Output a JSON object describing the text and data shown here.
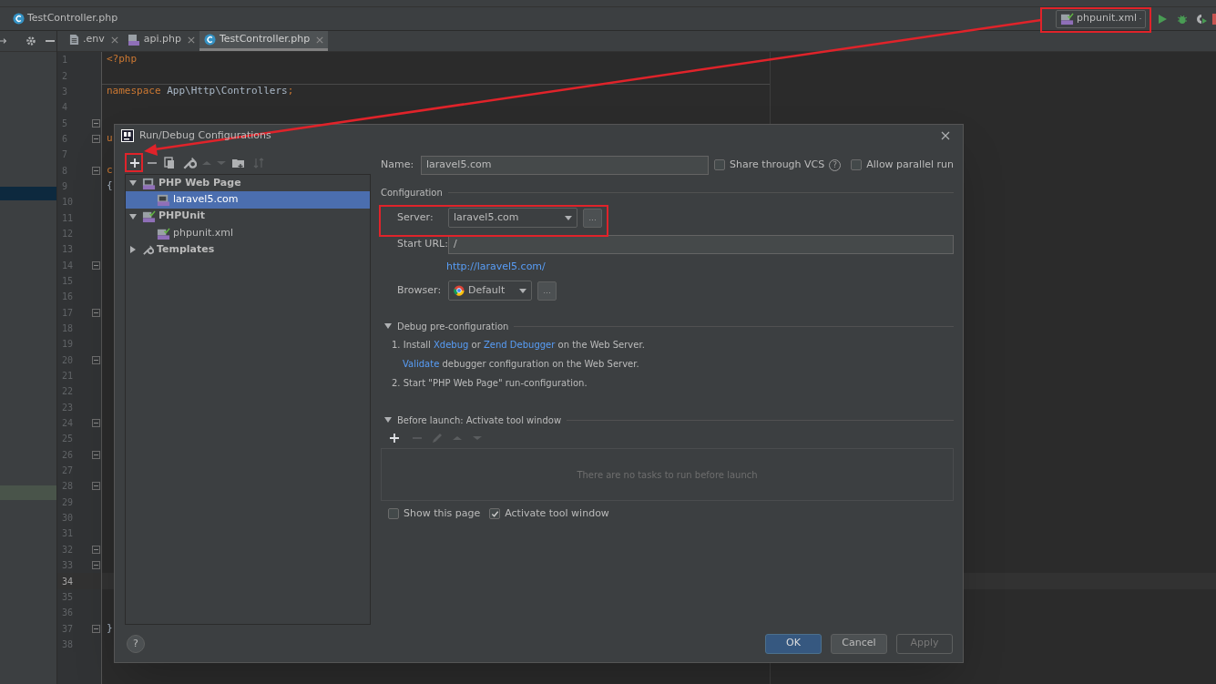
{
  "navbar": {
    "breadcrumb": "TestController.php",
    "run_configuration": "phpunit.xml"
  },
  "editor_tabs": [
    {
      "label": ".env",
      "kind": "text",
      "selected": false
    },
    {
      "label": "api.php",
      "kind": "php",
      "selected": false
    },
    {
      "label": "TestController.php",
      "kind": "class",
      "selected": true
    }
  ],
  "editor": {
    "lines": [
      {
        "number": "1",
        "fold": false,
        "current": false,
        "code": [
          {
            "text": "<?php",
            "kind": "keyword"
          }
        ]
      },
      {
        "number": "2",
        "fold": false,
        "current": false
      },
      {
        "number": "3",
        "fold": false,
        "current": false,
        "code": [
          {
            "text": "namespace",
            "kind": "keyword"
          },
          {
            "text": " App\\Http\\Controllers",
            "kind": "plain"
          },
          {
            "text": ";",
            "kind": "keyword"
          }
        ]
      },
      {
        "number": "4",
        "fold": false,
        "current": false
      },
      {
        "number": "5",
        "fold": true,
        "current": false
      },
      {
        "number": "6",
        "fold": true,
        "current": false,
        "code": [
          {
            "text": "u",
            "kind": "keyword"
          }
        ]
      },
      {
        "number": "7",
        "fold": false,
        "current": false
      },
      {
        "number": "8",
        "fold": true,
        "current": false,
        "code": [
          {
            "text": "c",
            "kind": "keyword"
          }
        ]
      },
      {
        "number": "9",
        "fold": false,
        "current": false,
        "code": [
          {
            "text": "{",
            "kind": "plain"
          }
        ]
      },
      {
        "number": "10",
        "fold": false,
        "current": false
      },
      {
        "number": "11",
        "fold": false,
        "current": false
      },
      {
        "number": "12",
        "fold": false,
        "current": false
      },
      {
        "number": "13",
        "fold": false,
        "current": false
      },
      {
        "number": "14",
        "fold": true,
        "current": false
      },
      {
        "number": "15",
        "fold": false,
        "current": false
      },
      {
        "number": "16",
        "fold": false,
        "current": false
      },
      {
        "number": "17",
        "fold": true,
        "current": false
      },
      {
        "number": "18",
        "fold": false,
        "current": false
      },
      {
        "number": "19",
        "fold": false,
        "current": false
      },
      {
        "number": "20",
        "fold": true,
        "current": false
      },
      {
        "number": "21",
        "fold": false,
        "current": false
      },
      {
        "number": "22",
        "fold": false,
        "current": false
      },
      {
        "number": "23",
        "fold": false,
        "current": false
      },
      {
        "number": "24",
        "fold": true,
        "current": false
      },
      {
        "number": "25",
        "fold": false,
        "current": false
      },
      {
        "number": "26",
        "fold": true,
        "current": false
      },
      {
        "number": "27",
        "fold": false,
        "current": false
      },
      {
        "number": "28",
        "fold": true,
        "current": false
      },
      {
        "number": "29",
        "fold": false,
        "current": false
      },
      {
        "number": "30",
        "fold": false,
        "current": false
      },
      {
        "number": "31",
        "fold": false,
        "current": false
      },
      {
        "number": "32",
        "fold": true,
        "current": false
      },
      {
        "number": "33",
        "fold": true,
        "current": false
      },
      {
        "number": "34",
        "fold": false,
        "current": true
      },
      {
        "number": "35",
        "fold": false,
        "current": false
      },
      {
        "number": "36",
        "fold": false,
        "current": false
      },
      {
        "number": "37",
        "fold": true,
        "current": false,
        "code": [
          {
            "text": "}",
            "kind": "plain"
          }
        ]
      },
      {
        "number": "38",
        "fold": false,
        "current": false
      }
    ]
  },
  "dialog": {
    "title": "Run/Debug Configurations",
    "tree": [
      {
        "label": "PHP Web Page",
        "kind": "webpage",
        "expanded": true,
        "selected": false,
        "children": [
          {
            "label": "laravel5.com",
            "kind": "webpage",
            "selected": true
          }
        ]
      },
      {
        "label": "PHPUnit",
        "kind": "phpunit",
        "expanded": true,
        "selected": false,
        "children": [
          {
            "label": "phpunit.xml",
            "kind": "phpunit",
            "selected": false
          }
        ]
      },
      {
        "label": "Templates",
        "kind": "templates",
        "expanded": false,
        "selected": false
      }
    ],
    "form": {
      "name": {
        "label": "Name:",
        "value": "laravel5.com"
      },
      "share_through_vcs": {
        "label": "Share through VCS",
        "checked": false,
        "hint": "?"
      },
      "allow_parallel_run": {
        "label": "Allow parallel run",
        "checked": false
      },
      "configuration": {
        "title": "Configuration",
        "server": {
          "label": "Server:",
          "value": "laravel5.com",
          "browse": "..."
        },
        "start_url": {
          "label": "Start URL:",
          "value": "/"
        },
        "url_link": "http://laravel5.com/",
        "browser": {
          "label": "Browser:",
          "value": "Default",
          "browse": "..."
        }
      },
      "debug_preconfiguration": {
        "title": "Debug pre-configuration",
        "expanded": true,
        "steps": [
          {
            "kind": "numbered",
            "segments": [
              {
                "text": "1. Install ",
                "kind": "text"
              },
              {
                "text": "Xdebug",
                "kind": "link"
              },
              {
                "text": " or ",
                "kind": "text"
              },
              {
                "text": "Zend Debugger",
                "kind": "link"
              },
              {
                "text": " on the Web Server.",
                "kind": "text"
              }
            ]
          },
          {
            "kind": "sub",
            "segments": [
              {
                "text": "Validate",
                "kind": "link"
              },
              {
                "text": " debugger configuration on the Web Server.",
                "kind": "text"
              }
            ]
          },
          {
            "kind": "numbered",
            "segments": [
              {
                "text": "2. Start \"PHP Web Page\" run-configuration.",
                "kind": "text"
              }
            ]
          }
        ]
      },
      "before_launch": {
        "title": "Before launch: Activate tool window",
        "expanded": true,
        "empty_text": "There are no tasks to run before launch",
        "show_this_page": {
          "label": "Show this page",
          "checked": false
        },
        "activate_tool_window": {
          "label": "Activate tool window",
          "checked": true
        }
      }
    },
    "help": "?",
    "buttons": [
      {
        "label": "OK",
        "kind": "primary"
      },
      {
        "label": "Cancel",
        "kind": "normal"
      },
      {
        "label": "Apply",
        "kind": "disabled"
      }
    ]
  }
}
